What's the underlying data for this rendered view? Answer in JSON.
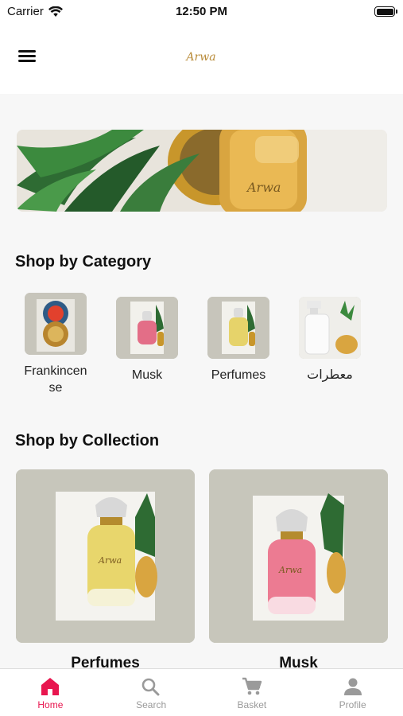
{
  "status_bar": {
    "carrier": "Carrier",
    "time": "12:50 PM"
  },
  "header": {
    "logo_text": "Arwa",
    "menu_icon": "hamburger-menu-icon"
  },
  "banner": {
    "icon": "perfume-bottle-photo"
  },
  "sections": {
    "category_title": "Shop by Category",
    "collection_title": "Shop by Collection"
  },
  "categories": [
    {
      "label": "Frankincense"
    },
    {
      "label": "Musk"
    },
    {
      "label": "Perfumes"
    },
    {
      "label": "معطرات"
    }
  ],
  "collections": [
    {
      "label": "Perfumes"
    },
    {
      "label": "Musk"
    }
  ],
  "tabbar": {
    "active_color": "#e8164f",
    "inactive_color": "#9a9a9a",
    "tabs": [
      {
        "label": "Home",
        "icon": "home-icon"
      },
      {
        "label": "Search",
        "icon": "search-icon"
      },
      {
        "label": "Basket",
        "icon": "cart-icon"
      },
      {
        "label": "Profile",
        "icon": "person-icon"
      }
    ]
  }
}
